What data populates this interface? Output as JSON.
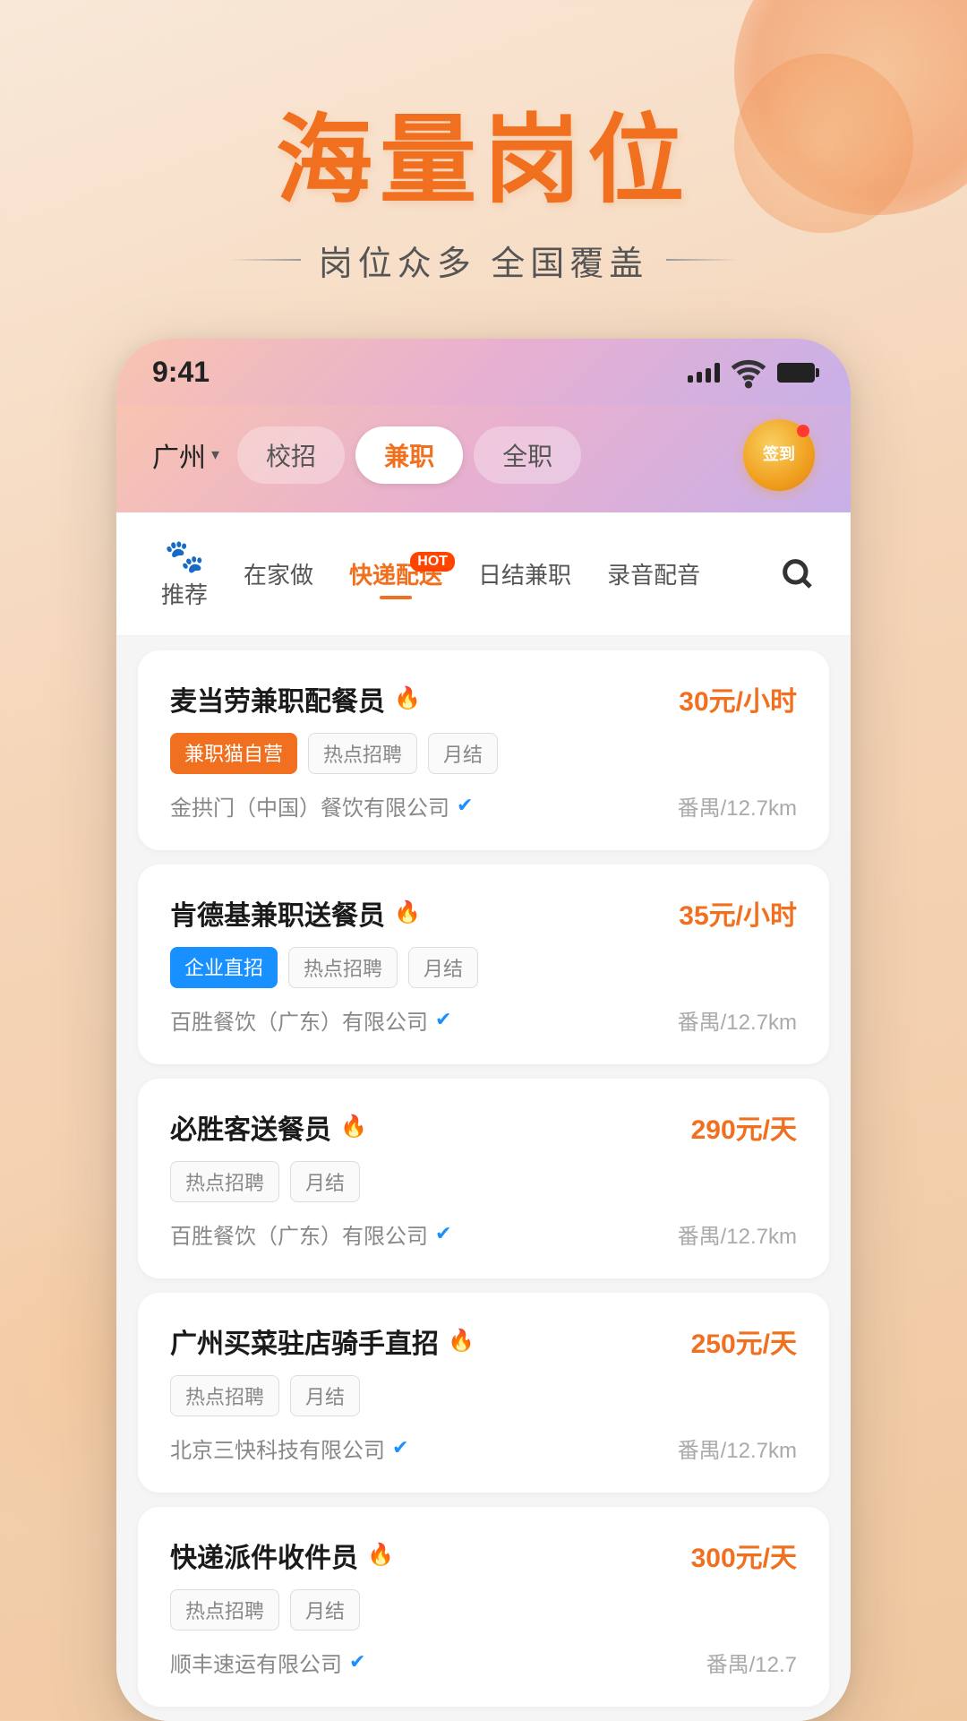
{
  "app": {
    "background_color": "#f9e4cc"
  },
  "header": {
    "main_title": "海量岗位",
    "subtitle": "岗位众多 全国覆盖"
  },
  "phone": {
    "status_bar": {
      "time": "9:41",
      "signal_label": "signal",
      "wifi_label": "wifi",
      "battery_label": "battery"
    },
    "nav": {
      "city": "广州",
      "tabs": [
        {
          "label": "校招",
          "active": false
        },
        {
          "label": "兼职",
          "active": true
        },
        {
          "label": "全职",
          "active": false
        }
      ],
      "sign_in": "签到"
    },
    "categories": [
      {
        "label": "推荐",
        "icon": "🐾",
        "active": false,
        "has_icon": true
      },
      {
        "label": "在家做",
        "active": false
      },
      {
        "label": "快递配送",
        "active": true,
        "hot": true
      },
      {
        "label": "日结兼职",
        "active": false
      },
      {
        "label": "录音配音",
        "active": false
      }
    ],
    "jobs": [
      {
        "title": "麦当劳兼职配餐员",
        "salary": "30元/小时",
        "tags": [
          {
            "text": "兼职猫自营",
            "type": "orange"
          },
          {
            "text": "热点招聘",
            "type": "outline"
          },
          {
            "text": "月结",
            "type": "outline"
          }
        ],
        "company": "金拱门（中国）餐饮有限公司",
        "verified": true,
        "location": "番禺/12.7km"
      },
      {
        "title": "肯德基兼职送餐员",
        "salary": "35元/小时",
        "tags": [
          {
            "text": "企业直招",
            "type": "blue"
          },
          {
            "text": "热点招聘",
            "type": "outline"
          },
          {
            "text": "月结",
            "type": "outline"
          }
        ],
        "company": "百胜餐饮（广东）有限公司",
        "verified": true,
        "location": "番禺/12.7km"
      },
      {
        "title": "必胜客送餐员",
        "salary": "290元/天",
        "tags": [
          {
            "text": "热点招聘",
            "type": "outline"
          },
          {
            "text": "月结",
            "type": "outline"
          }
        ],
        "company": "百胜餐饮（广东）有限公司",
        "verified": true,
        "location": "番禺/12.7km"
      },
      {
        "title": "广州买菜驻店骑手直招",
        "salary": "250元/天",
        "tags": [
          {
            "text": "热点招聘",
            "type": "outline"
          },
          {
            "text": "月结",
            "type": "outline"
          }
        ],
        "company": "北京三快科技有限公司",
        "verified": true,
        "location": "番禺/12.7km"
      },
      {
        "title": "快递派件收件员",
        "salary": "300元/天",
        "tags": [
          {
            "text": "热点招聘",
            "type": "outline"
          },
          {
            "text": "月结",
            "type": "outline"
          }
        ],
        "company": "顺丰速运有限公司",
        "verified": true,
        "location": "番禺/12.7"
      }
    ]
  }
}
